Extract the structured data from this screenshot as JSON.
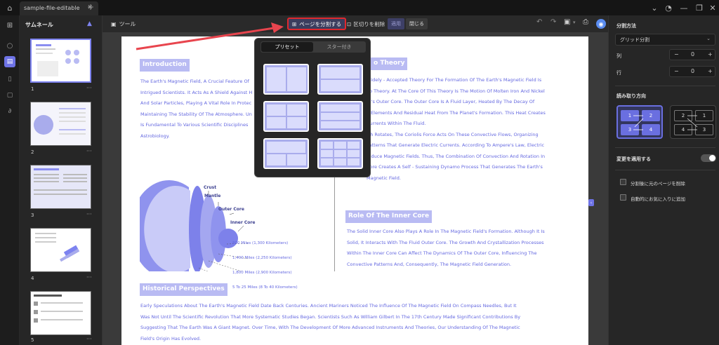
{
  "window": {
    "tab_title": "sample-file-editable"
  },
  "thumbnail_panel": {
    "title": "サムネール",
    "pages": [
      "1",
      "2",
      "3",
      "4",
      "5"
    ]
  },
  "toolbar": {
    "tools_label": "ツール",
    "split_label": "ページを分割する",
    "remove_split_label": "区切りを削除",
    "apply_label": "適用",
    "close_label": "閉じる"
  },
  "popup": {
    "tabs": [
      "プリセット",
      "スター付き"
    ],
    "active_tab": "プリセット",
    "layouts": [
      "2 columns",
      "2 rows",
      "4 quadrants",
      "3 rows",
      "wide top, 2 bottom",
      "3 x 3 grid"
    ]
  },
  "right_panel": {
    "split_method_label": "分割方法",
    "split_method_value": "グリッド分割",
    "columns_label": "列",
    "columns_value": "0",
    "rows_label": "行",
    "rows_value": "0",
    "reading_direction_label": "読み取り方向",
    "direction_a": [
      "1",
      "2",
      "3",
      "4"
    ],
    "direction_b": [
      "2",
      "1",
      "4",
      "3"
    ],
    "apply_changes_label": "変更を適用する",
    "delete_original_label": "分割後に元のページを削除",
    "auto_favorite_label": "自動的にお気に入りに追加"
  },
  "document": {
    "introduction": {
      "heading": "Introduction",
      "lines": [
        "The Earth's Magnetic Field, A Crucial Feature Of",
        "Intrigued Scientists. It Acts As A Shield Against H",
        "And Solar Particles, Playing A Vital Role In Protec",
        "Maintaining The Stability Of The Atmosphere. Un",
        "Is Fundamental To Various Scientific Disciplines",
        "Astrobiology."
      ]
    },
    "dynamo": {
      "heading": "o Theory",
      "lines": [
        "Widely - Accepted Theory For The Formation Of The Earth's Magnetic Field Is",
        "no Theory. At The Core Of This Theory Is The Motion Of Molten Iron And Nickel",
        "th's Outer Core. The Outer Core Is A Fluid Layer, Heated By The Decay Of",
        "e Elements And Residual Heat From The Planet's Formation. This Heat Creates",
        "Currents Within The Fluid.",
        "rth Rotates, The Coriolis Force Acts On These Convective Flows, Organizing",
        "Patterns That Generate Electric Currents. According To Ampere's Law, Electric",
        "roduce Magnetic Fields. Thus, The Combination Of Convection And Rotation In",
        "Core Creates A Self - Sustaining Dynamo Process That Generates The Earth's",
        "Magnetic Field."
      ]
    },
    "inner_core": {
      "heading": "Role Of The Inner Core",
      "lines": [
        "The Solid Inner Core Also Plays A Role In The Magnetic Field's Formation. Although It Is",
        "Solid, It Interacts With The Fluid Outer Core. The Growth And Crystallization Processes",
        "Within The Inner Core Can Affect The Dynamics Of The Outer Core, Influencing The",
        "Convective Patterns And, Consequently, The Magnetic Field Generation."
      ]
    },
    "historical": {
      "heading": "Historical Perspectives",
      "lines": [
        "Early Speculations About The Earth's Magnetic Field Date Back Centuries. Ancient Mariners Noticed The Influence Of The Magnetic Field On Compass Needles, But It",
        "Was Not Until The Scientific Revolution That More Systematic Studies Began. Scientists Such As William Gilbert In The 17th Century Made Significant Contributions By",
        "Suggesting That The Earth Was A Giant Magnet. Over Time, With The Development Of More Advanced Instruments And Theories, Our Understanding Of The Magnetic",
        "Field's Origin Has Evolved."
      ]
    },
    "diagram": {
      "labels": {
        "crust": "Crust",
        "mantle": "Mantle",
        "outer_core": "Outer Core",
        "inner_core": "Inner Core"
      },
      "depths": [
        "800 Miles (1,300 Kilometers)",
        "1,400 Miles (2,250 Kilometers)",
        "1,800 Miles (2,900 Kilometers)",
        "5 To 25 Miles (8 To 40 Kilometers)"
      ]
    }
  },
  "colors": {
    "accent": "#6468e0",
    "heading_bg": "#b9bbf3",
    "highlight_border": "#e0282e",
    "arrow": "#e8454e"
  }
}
